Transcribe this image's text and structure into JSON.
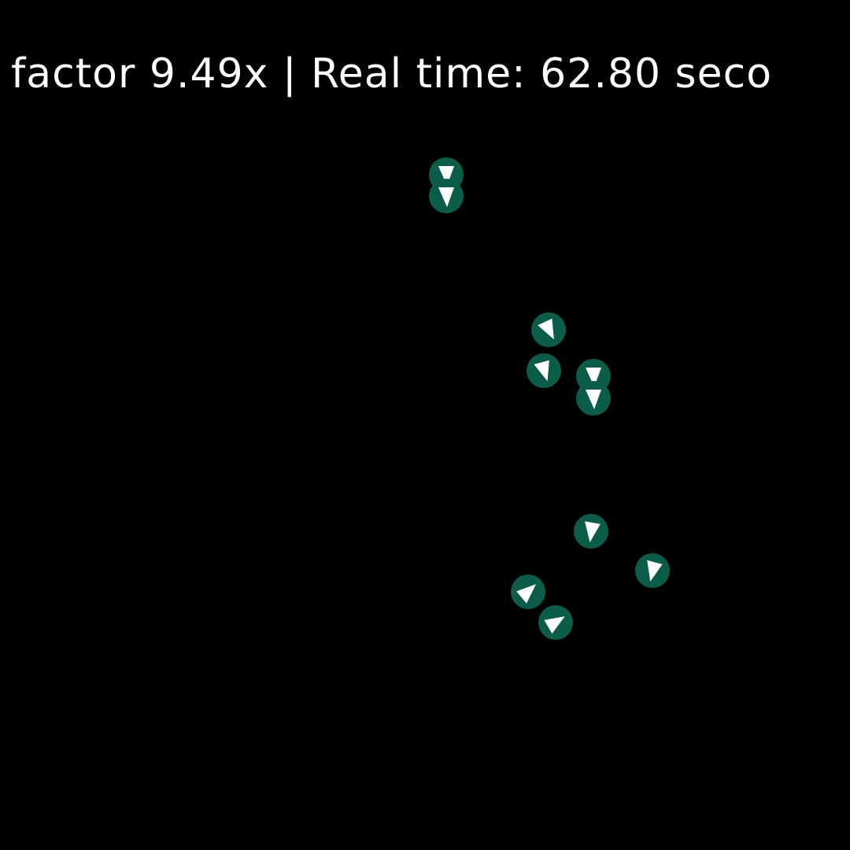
{
  "hud": {
    "status_line": "factor 9.49x | Real time: 62.80 seco"
  },
  "colors": {
    "background": "#000000",
    "agent_body": "#0b5d49",
    "agent_heading": "#ffffff",
    "text": "#ffffff"
  }
}
